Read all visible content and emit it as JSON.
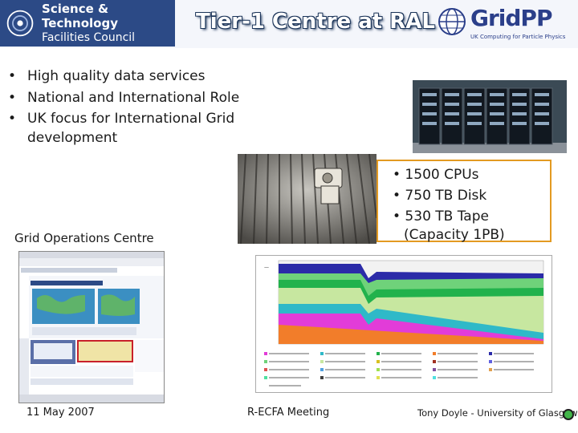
{
  "header": {
    "org_name_line1": "Science & Technology",
    "org_name_line2": "Facilities Council",
    "title": "Tier-1 Centre at RAL",
    "gridpp_name": "GridPP",
    "gridpp_tagline": "UK Computing for Particle Physics"
  },
  "bullets": [
    "High quality data services",
    "National and International Role",
    "UK focus for International Grid development"
  ],
  "specs": {
    "cpus": "• 1500 CPUs",
    "disk": "• 750 TB Disk",
    "tape": "• 530 TB Tape",
    "capacity": "(Capacity 1PB)"
  },
  "goc_label": "Grid Operations Centre",
  "footer": {
    "date": "11 May 2007",
    "meeting": "R-ECFA Meeting",
    "author": "Tony Doyle - University of Glasgow"
  },
  "colors": {
    "header_bg": "#2c4a86",
    "spec_border": "#e39a21",
    "gridpp_blue": "#2b3f8a",
    "status_dot": "#42b549"
  }
}
